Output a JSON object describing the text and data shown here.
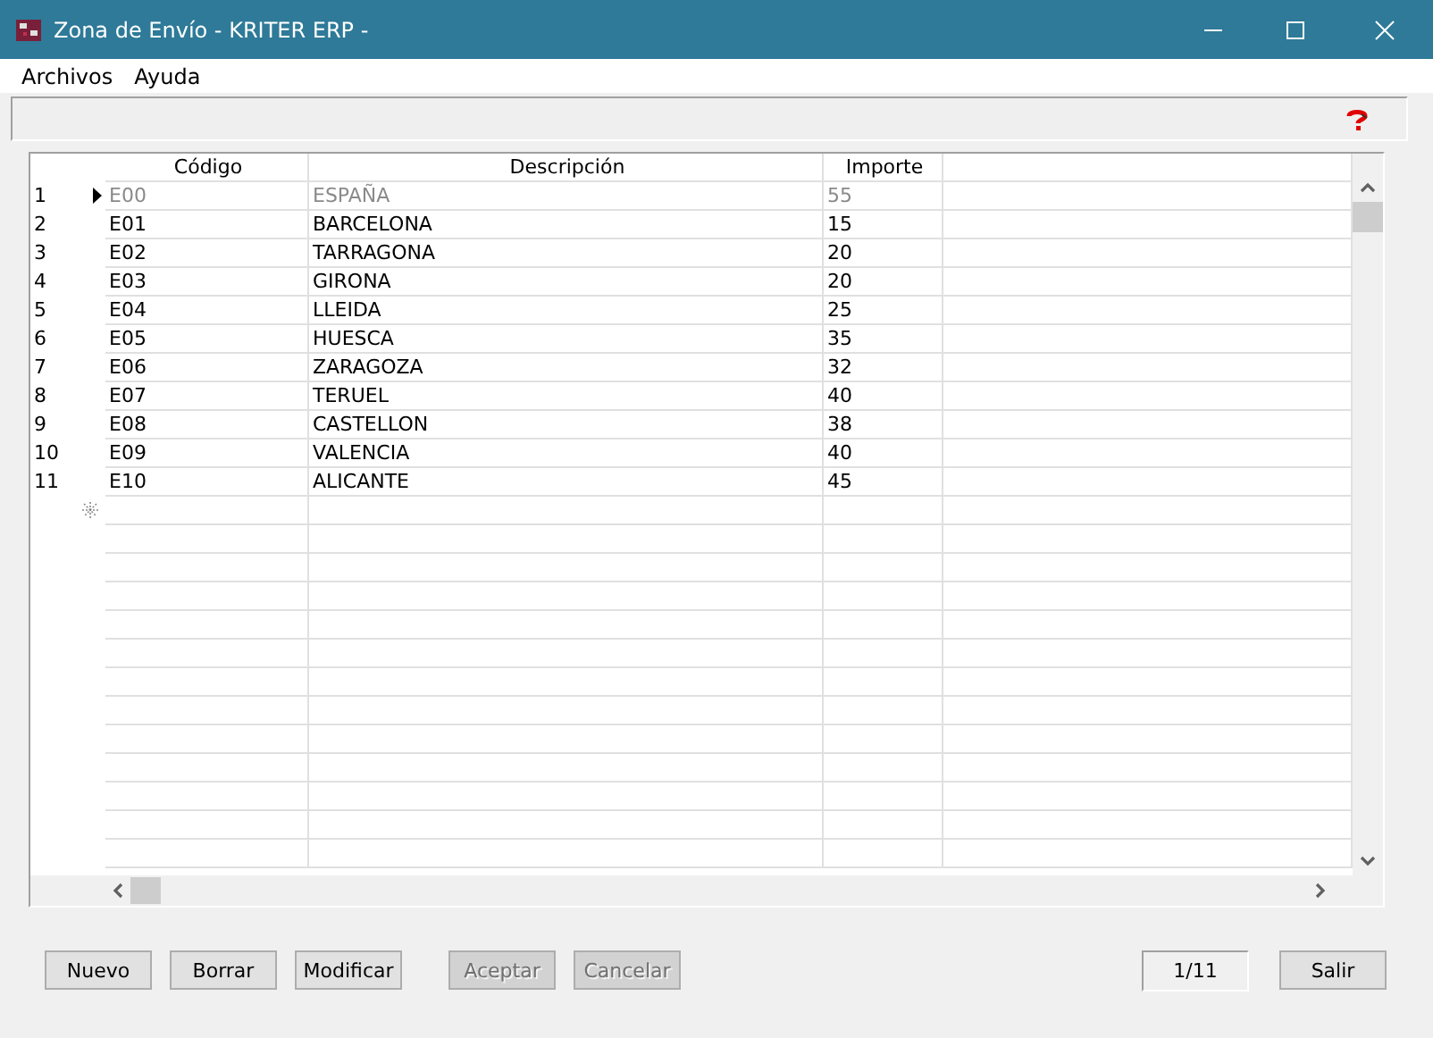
{
  "window": {
    "title": "Zona de Envío - KRITER ERP -"
  },
  "menu": [
    "Archivos",
    "Ayuda"
  ],
  "table": {
    "columns": [
      "Código",
      "Descripción",
      "Importe"
    ],
    "rows": [
      {
        "number": "1",
        "selected": true,
        "cells": [
          "E00",
          "ESPAÑA",
          "55"
        ]
      },
      {
        "number": "2",
        "selected": false,
        "cells": [
          "E01",
          "BARCELONA",
          "15"
        ]
      },
      {
        "number": "3",
        "selected": false,
        "cells": [
          "E02",
          "TARRAGONA",
          "20"
        ]
      },
      {
        "number": "4",
        "selected": false,
        "cells": [
          "E03",
          "GIRONA",
          "20"
        ]
      },
      {
        "number": "5",
        "selected": false,
        "cells": [
          "E04",
          "LLEIDA",
          "25"
        ]
      },
      {
        "number": "6",
        "selected": false,
        "cells": [
          "E05",
          "HUESCA",
          "35"
        ]
      },
      {
        "number": "7",
        "selected": false,
        "cells": [
          "E06",
          "ZARAGOZA",
          "32"
        ]
      },
      {
        "number": "8",
        "selected": false,
        "cells": [
          "E07",
          "TERUEL",
          "40"
        ]
      },
      {
        "number": "9",
        "selected": false,
        "cells": [
          "E08",
          "CASTELLON",
          "38"
        ]
      },
      {
        "number": "10",
        "selected": false,
        "cells": [
          "E09",
          "VALENCIA",
          "40"
        ]
      },
      {
        "number": "11",
        "selected": false,
        "cells": [
          "E10",
          "ALICANTE",
          "45"
        ]
      }
    ]
  },
  "buttons": [
    {
      "label": "Nuevo",
      "disabled": false
    },
    {
      "label": "Borrar",
      "disabled": false
    },
    {
      "label": "Modificar",
      "disabled": false
    },
    {
      "label": "Aceptar",
      "disabled": true
    },
    {
      "label": "Cancelar",
      "disabled": true
    }
  ],
  "record_counter": "1/11",
  "exit_button": {
    "label": "Salir",
    "disabled": false
  }
}
